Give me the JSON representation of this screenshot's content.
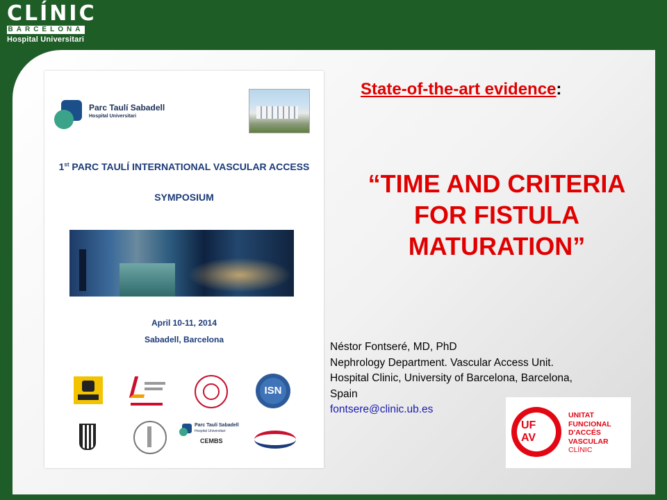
{
  "header": {
    "logo_main": "CLÍNIC",
    "logo_bar": "BARCELONA",
    "logo_sub": "Hospital Universitari"
  },
  "poster": {
    "org_name": "Parc Taulí Sabadell",
    "org_sub": "Hospital Universitari",
    "title_sup": "st",
    "title_line1_pre": "1",
    "title_line1": "PARC TAULÍ INTERNATIONAL VASCULAR ACCESS",
    "title_line2": "SYMPOSIUM",
    "date": "April 10-11,  2014",
    "place": "Sabadell, Barcelona",
    "sponsor_cembs_title": "Parc Taulí Sabadell",
    "sponsor_cembs_sub": "Hospital Universitari",
    "sponsor_cembs_name": "CEMBS",
    "sponsor_isn": "ISN"
  },
  "slide": {
    "heading": "State-of-the-art evidence",
    "heading_colon": ":",
    "title_line1": "“TIME AND CRITERIA",
    "title_line2": "FOR FISTULA",
    "title_line3": "MATURATION”",
    "author_name": "Néstor Fontseré, MD, PhD",
    "author_dept": "Nephrology Department. Vascular Access Unit.",
    "author_inst_1": "Hospital Clinic, University of Barcelona, Barcelona,",
    "author_inst_2": "Spain",
    "author_email": "fontsere@clinic.ub.es"
  },
  "ufav_logo": {
    "uf": "UF",
    "av": "AV",
    "line1": "UNITAT",
    "line2": "FUNCIONAL",
    "line3": "D'ACCÉS",
    "line4": "VASCULAR",
    "line5": "CLÍNIC"
  },
  "colors": {
    "brand_green": "#1f5d27",
    "title_red": "#e00000",
    "email_blue": "#1a1ab0",
    "ufav_red": "#e30613"
  }
}
